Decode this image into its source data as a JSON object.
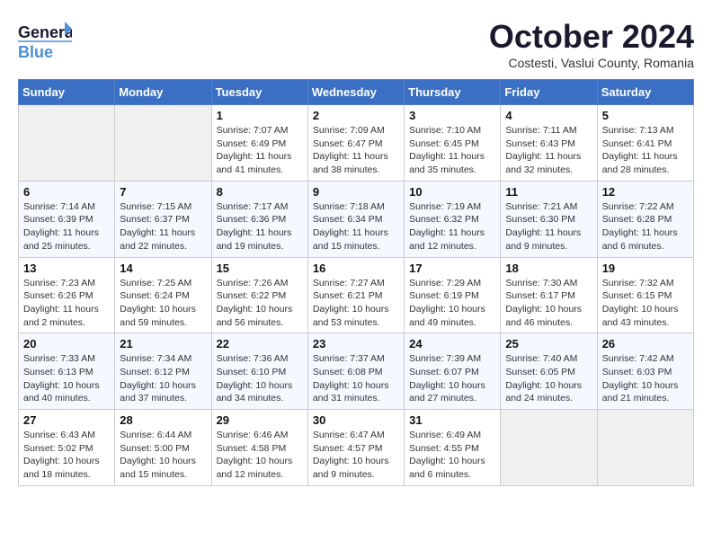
{
  "header": {
    "logo_general": "General",
    "logo_blue": "Blue",
    "month_title": "October 2024",
    "location": "Costesti, Vaslui County, Romania"
  },
  "days_of_week": [
    "Sunday",
    "Monday",
    "Tuesday",
    "Wednesday",
    "Thursday",
    "Friday",
    "Saturday"
  ],
  "weeks": [
    [
      {
        "day": "",
        "info": ""
      },
      {
        "day": "",
        "info": ""
      },
      {
        "day": "1",
        "info": "Sunrise: 7:07 AM\nSunset: 6:49 PM\nDaylight: 11 hours and 41 minutes."
      },
      {
        "day": "2",
        "info": "Sunrise: 7:09 AM\nSunset: 6:47 PM\nDaylight: 11 hours and 38 minutes."
      },
      {
        "day": "3",
        "info": "Sunrise: 7:10 AM\nSunset: 6:45 PM\nDaylight: 11 hours and 35 minutes."
      },
      {
        "day": "4",
        "info": "Sunrise: 7:11 AM\nSunset: 6:43 PM\nDaylight: 11 hours and 32 minutes."
      },
      {
        "day": "5",
        "info": "Sunrise: 7:13 AM\nSunset: 6:41 PM\nDaylight: 11 hours and 28 minutes."
      }
    ],
    [
      {
        "day": "6",
        "info": "Sunrise: 7:14 AM\nSunset: 6:39 PM\nDaylight: 11 hours and 25 minutes."
      },
      {
        "day": "7",
        "info": "Sunrise: 7:15 AM\nSunset: 6:37 PM\nDaylight: 11 hours and 22 minutes."
      },
      {
        "day": "8",
        "info": "Sunrise: 7:17 AM\nSunset: 6:36 PM\nDaylight: 11 hours and 19 minutes."
      },
      {
        "day": "9",
        "info": "Sunrise: 7:18 AM\nSunset: 6:34 PM\nDaylight: 11 hours and 15 minutes."
      },
      {
        "day": "10",
        "info": "Sunrise: 7:19 AM\nSunset: 6:32 PM\nDaylight: 11 hours and 12 minutes."
      },
      {
        "day": "11",
        "info": "Sunrise: 7:21 AM\nSunset: 6:30 PM\nDaylight: 11 hours and 9 minutes."
      },
      {
        "day": "12",
        "info": "Sunrise: 7:22 AM\nSunset: 6:28 PM\nDaylight: 11 hours and 6 minutes."
      }
    ],
    [
      {
        "day": "13",
        "info": "Sunrise: 7:23 AM\nSunset: 6:26 PM\nDaylight: 11 hours and 2 minutes."
      },
      {
        "day": "14",
        "info": "Sunrise: 7:25 AM\nSunset: 6:24 PM\nDaylight: 10 hours and 59 minutes."
      },
      {
        "day": "15",
        "info": "Sunrise: 7:26 AM\nSunset: 6:22 PM\nDaylight: 10 hours and 56 minutes."
      },
      {
        "day": "16",
        "info": "Sunrise: 7:27 AM\nSunset: 6:21 PM\nDaylight: 10 hours and 53 minutes."
      },
      {
        "day": "17",
        "info": "Sunrise: 7:29 AM\nSunset: 6:19 PM\nDaylight: 10 hours and 49 minutes."
      },
      {
        "day": "18",
        "info": "Sunrise: 7:30 AM\nSunset: 6:17 PM\nDaylight: 10 hours and 46 minutes."
      },
      {
        "day": "19",
        "info": "Sunrise: 7:32 AM\nSunset: 6:15 PM\nDaylight: 10 hours and 43 minutes."
      }
    ],
    [
      {
        "day": "20",
        "info": "Sunrise: 7:33 AM\nSunset: 6:13 PM\nDaylight: 10 hours and 40 minutes."
      },
      {
        "day": "21",
        "info": "Sunrise: 7:34 AM\nSunset: 6:12 PM\nDaylight: 10 hours and 37 minutes."
      },
      {
        "day": "22",
        "info": "Sunrise: 7:36 AM\nSunset: 6:10 PM\nDaylight: 10 hours and 34 minutes."
      },
      {
        "day": "23",
        "info": "Sunrise: 7:37 AM\nSunset: 6:08 PM\nDaylight: 10 hours and 31 minutes."
      },
      {
        "day": "24",
        "info": "Sunrise: 7:39 AM\nSunset: 6:07 PM\nDaylight: 10 hours and 27 minutes."
      },
      {
        "day": "25",
        "info": "Sunrise: 7:40 AM\nSunset: 6:05 PM\nDaylight: 10 hours and 24 minutes."
      },
      {
        "day": "26",
        "info": "Sunrise: 7:42 AM\nSunset: 6:03 PM\nDaylight: 10 hours and 21 minutes."
      }
    ],
    [
      {
        "day": "27",
        "info": "Sunrise: 6:43 AM\nSunset: 5:02 PM\nDaylight: 10 hours and 18 minutes."
      },
      {
        "day": "28",
        "info": "Sunrise: 6:44 AM\nSunset: 5:00 PM\nDaylight: 10 hours and 15 minutes."
      },
      {
        "day": "29",
        "info": "Sunrise: 6:46 AM\nSunset: 4:58 PM\nDaylight: 10 hours and 12 minutes."
      },
      {
        "day": "30",
        "info": "Sunrise: 6:47 AM\nSunset: 4:57 PM\nDaylight: 10 hours and 9 minutes."
      },
      {
        "day": "31",
        "info": "Sunrise: 6:49 AM\nSunset: 4:55 PM\nDaylight: 10 hours and 6 minutes."
      },
      {
        "day": "",
        "info": ""
      },
      {
        "day": "",
        "info": ""
      }
    ]
  ]
}
